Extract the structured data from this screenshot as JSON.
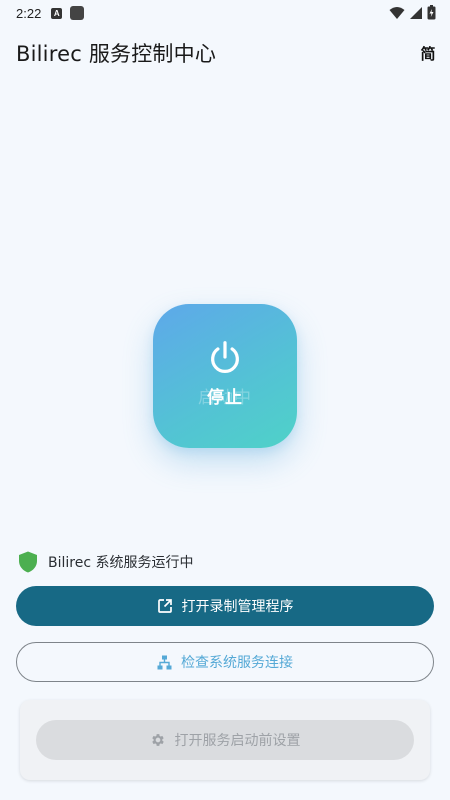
{
  "status_bar": {
    "time": "2:22",
    "left_icons": [
      "font-icon",
      "app-square-icon"
    ],
    "right_icons": [
      "wifi-icon",
      "signal-icon",
      "battery-icon"
    ]
  },
  "app_bar": {
    "title": "Bilirec 服务控制中心",
    "language_toggle": "简"
  },
  "power": {
    "icon": "power-icon",
    "label": "停止",
    "ghost_label": "启动中",
    "gradient": [
      "#5ea8ea",
      "#4fd2c8"
    ]
  },
  "service_status": {
    "icon": "shield-icon",
    "text": "Bilirec 系统服务运行中",
    "color": "#4caf50"
  },
  "actions": {
    "open_manager": {
      "icon": "external-link-icon",
      "label": "打开录制管理程序",
      "color": "#176985"
    },
    "check_connection": {
      "icon": "network-icon",
      "label": "检查系统服务连接",
      "color": "#55a9d6"
    },
    "pre_start_settings": {
      "icon": "gear-icon",
      "label": "打开服务启动前设置",
      "enabled": false
    }
  }
}
